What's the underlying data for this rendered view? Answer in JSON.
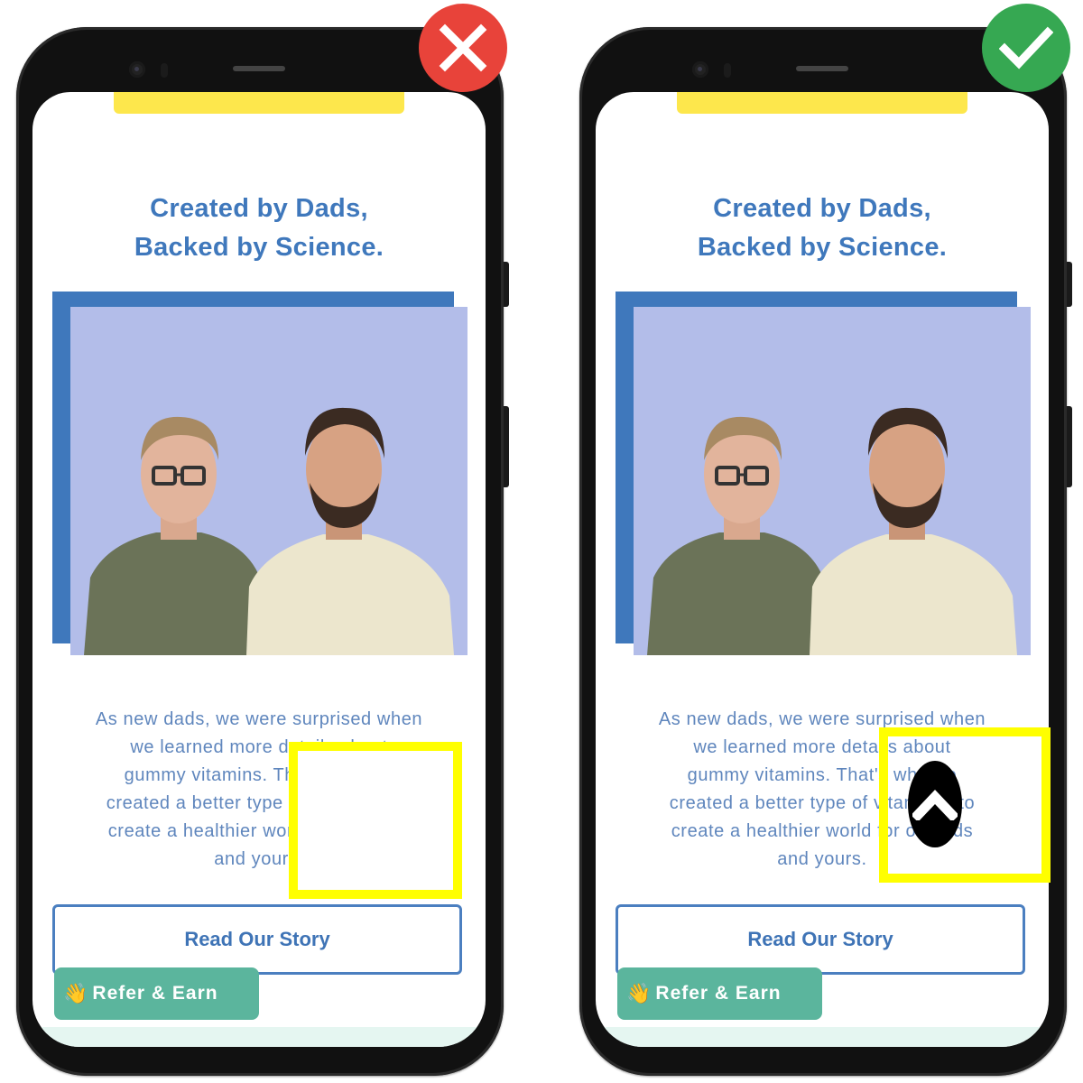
{
  "comparison": {
    "bad_label": "incorrect-example",
    "good_label": "correct-example"
  },
  "colors": {
    "wrong_badge": "#e8433a",
    "right_badge": "#36a852",
    "highlight": "#ffff00",
    "brand_blue": "#3f78bc",
    "promo_yellow": "#fde74c",
    "refer_green": "#5bb59d"
  },
  "left_phone": {
    "headline_line1": "Created by Dads,",
    "headline_line2": "Backed by Science.",
    "photo_alt": "Two founders smiling in front of a light purple wall",
    "body_lines": [
      "As new dads, we were surprised when",
      "we learned more details about",
      "gummy vitamins. That's why we",
      "created a better type of vitamin -- to",
      "create a healthier world for our kids",
      "and yours."
    ],
    "read_story_label": "Read Our Story",
    "refer_label": "Refer & Earn",
    "badge_icon": "close-icon"
  },
  "right_phone": {
    "headline_line1": "Created by Dads,",
    "headline_line2": "Backed by Science.",
    "photo_alt": "Two founders smiling in front of a light purple wall",
    "body_lines": [
      "As new dads, we were surprised when",
      "we learned more details about",
      "gummy vitamins. That's why we",
      "created a better type of vitamin -- to",
      "create a healthier world for our kids",
      "and yours."
    ],
    "read_story_label": "Read Our Story",
    "refer_label": "Refer & Earn",
    "badge_icon": "check-icon",
    "scroll_button_icon": "chevron-up-icon"
  }
}
